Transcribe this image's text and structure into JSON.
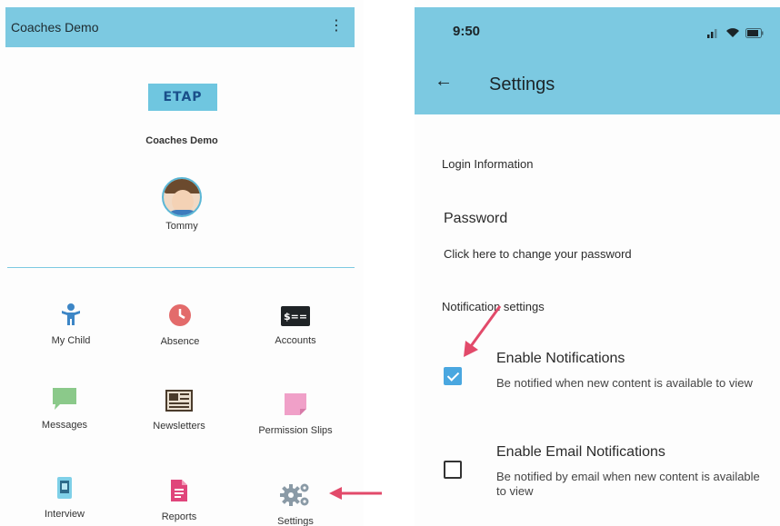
{
  "left_screen": {
    "appbar_title": "Coaches Demo",
    "menu_glyph": "⋮",
    "logo_text": "ETAP",
    "school_name": "Coaches Demo",
    "child_name": "Tommy",
    "grid": [
      {
        "label": "My Child",
        "icon": "child-icon"
      },
      {
        "label": "Absence",
        "icon": "clock-icon"
      },
      {
        "label": "Accounts",
        "icon": "money-icon"
      },
      {
        "label": "Messages",
        "icon": "message-icon"
      },
      {
        "label": "Newsletters",
        "icon": "newspaper-icon"
      },
      {
        "label": "Permission Slips",
        "icon": "permission-slip-icon"
      },
      {
        "label": "Interview",
        "icon": "phone-icon"
      },
      {
        "label": "Reports",
        "icon": "report-icon"
      },
      {
        "label": "Settings",
        "icon": "gears-icon"
      }
    ],
    "money_icon_text": "$=="
  },
  "right_screen": {
    "time": "9:50",
    "back_glyph": "←",
    "title": "Settings",
    "login_info": "Login Information",
    "password_title": "Password",
    "password_sub": "Click here to change your password",
    "notification_settings": "Notification settings",
    "prefs": [
      {
        "title": "Enable Notifications",
        "subtitle": "Be notified when new content is available to view",
        "checked": true
      },
      {
        "title": "Enable Email Notifications",
        "subtitle": "Be notified by email when new content is available to view",
        "checked": false
      }
    ]
  },
  "colors": {
    "appbar": "#7cc9e1",
    "checkbox": "#4aa7e0",
    "annotation_arrow": "#e24a6a"
  }
}
